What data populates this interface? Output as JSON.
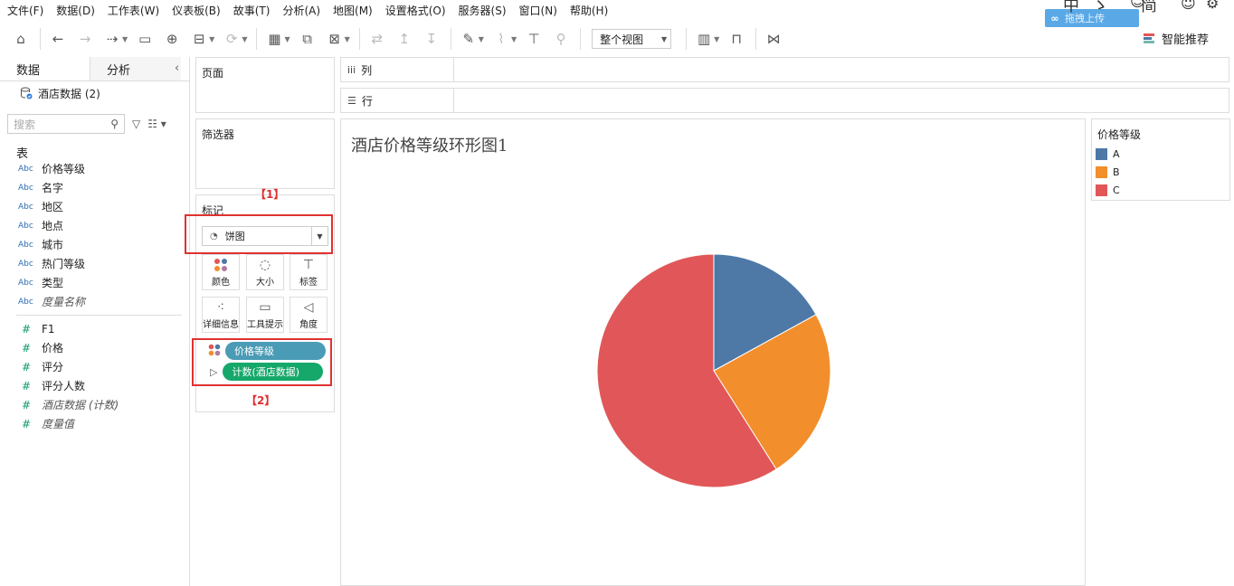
{
  "menu": [
    "文件(F)",
    "数据(D)",
    "工作表(W)",
    "仪表板(B)",
    "故事(T)",
    "分析(A)",
    "地图(M)",
    "设置格式(O)",
    "服务器(S)",
    "窗口(N)",
    "帮助(H)"
  ],
  "overlay": {
    "upload_label": "拖拽上传",
    "glyphs": [
      "中",
      "ゝ",
      "简",
      "☺",
      "⚙"
    ]
  },
  "toolbar": {
    "view_mode": "整个视图",
    "smart_label": "智能推荐"
  },
  "data_pane": {
    "tab_data": "数据",
    "tab_analysis": "分析",
    "datasource": "酒店数据 (2)",
    "search_placeholder": "搜索",
    "section": "表",
    "dimensions": [
      {
        "type": "Abc",
        "name": "价格等级"
      },
      {
        "type": "Abc",
        "name": "名字"
      },
      {
        "type": "Abc",
        "name": "地区"
      },
      {
        "type": "Abc",
        "name": "地点"
      },
      {
        "type": "Abc",
        "name": "城市"
      },
      {
        "type": "Abc",
        "name": "热门等级"
      },
      {
        "type": "Abc",
        "name": "类型"
      },
      {
        "type": "Abc",
        "name": "度量名称"
      }
    ],
    "measures": [
      {
        "type": "#",
        "name": "F1"
      },
      {
        "type": "#",
        "name": "价格"
      },
      {
        "type": "#",
        "name": "评分"
      },
      {
        "type": "#",
        "name": "评分人数"
      },
      {
        "type": "#",
        "name": "酒店数据 (计数)"
      },
      {
        "type": "#",
        "name": "度量值"
      }
    ]
  },
  "cards": {
    "pages": "页面",
    "filters": "筛选器",
    "marks": "标记",
    "mark_type": "饼图",
    "buttons": [
      "颜色",
      "大小",
      "标签",
      "详细信息",
      "工具提示",
      "角度"
    ],
    "pill_color": "价格等级",
    "pill_angle": "计数(酒店数据)",
    "annotation_1": "【1】",
    "annotation_2": "【2】"
  },
  "shelves": {
    "columns": "列",
    "rows": "行"
  },
  "view": {
    "title": "酒店价格等级环形图1"
  },
  "legend": {
    "title": "价格等级"
  },
  "chart_data": {
    "type": "pie",
    "title": "酒店价格等级环形图1",
    "categories": [
      "A",
      "B",
      "C"
    ],
    "values": [
      17,
      24,
      59
    ],
    "colors": [
      "#4e79a7",
      "#f28e2b",
      "#e15759"
    ],
    "legend_position": "right"
  }
}
